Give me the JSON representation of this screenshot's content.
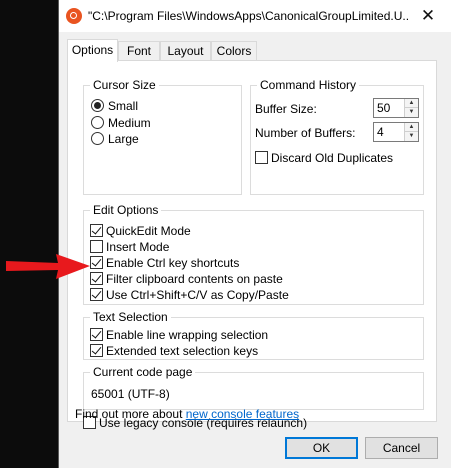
{
  "window": {
    "title": "\"C:\\Program Files\\WindowsApps\\CanonicalGroupLimited.U...",
    "close_glyph": "✕",
    "app_icon": "ubuntu-icon"
  },
  "tabs": [
    {
      "label": "Options",
      "active": true
    },
    {
      "label": "Font",
      "active": false
    },
    {
      "label": "Layout",
      "active": false
    },
    {
      "label": "Colors",
      "active": false
    }
  ],
  "cursor_size": {
    "title": "Cursor Size",
    "options": [
      {
        "label": "Small",
        "selected": true
      },
      {
        "label": "Medium",
        "selected": false
      },
      {
        "label": "Large",
        "selected": false
      }
    ]
  },
  "command_history": {
    "title": "Command History",
    "buffer_size_label": "Buffer Size:",
    "buffer_size_value": "50",
    "num_buffers_label": "Number of Buffers:",
    "num_buffers_value": "4",
    "discard_label": "Discard Old Duplicates",
    "discard_checked": false
  },
  "edit_options": {
    "title": "Edit Options",
    "items": [
      {
        "label": "QuickEdit Mode",
        "checked": true
      },
      {
        "label": "Insert Mode",
        "checked": false
      },
      {
        "label": "Enable Ctrl key shortcuts",
        "checked": true
      },
      {
        "label": "Filter clipboard contents on paste",
        "checked": true
      },
      {
        "label": "Use Ctrl+Shift+C/V as Copy/Paste",
        "checked": true
      }
    ]
  },
  "text_selection": {
    "title": "Text Selection",
    "items": [
      {
        "label": "Enable line wrapping selection",
        "checked": true
      },
      {
        "label": "Extended text selection keys",
        "checked": true
      }
    ]
  },
  "code_page": {
    "title": "Current code page",
    "value": "65001 (UTF-8)"
  },
  "legacy": {
    "label": "Use legacy console (requires relaunch)",
    "checked": false
  },
  "find_out": {
    "text": "Find out more about ",
    "link": "new console features"
  },
  "buttons": {
    "ok": "OK",
    "cancel": "Cancel"
  },
  "annotation": {
    "arrow_color": "#e8191d"
  }
}
